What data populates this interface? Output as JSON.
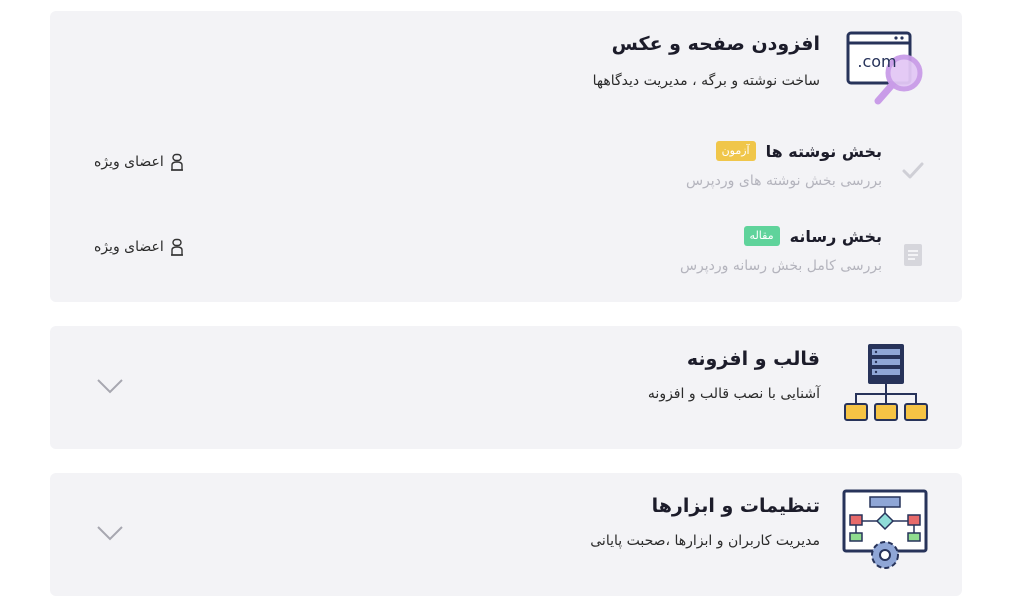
{
  "sections": [
    {
      "title": "افزودن صفحه و عکس",
      "subtitle": "ساخت نوشته و برگه ، مدیریت دیدگاهها",
      "icon": "domain-search-icon",
      "expanded": true,
      "icon_text": ".com",
      "lessons": [
        {
          "title": "بخش نوشته ها",
          "badge": "آزمون",
          "badge_color": "#f0c64a",
          "description": "بررسی بخش نوشته های وردپرس",
          "access": "اعضای ویژه",
          "icon": "check-icon"
        },
        {
          "title": "بخش رسانه",
          "badge": "مقاله",
          "badge_color": "#5fd39b",
          "description": "بررسی کامل بخش رسانه وردپرس",
          "access": "اعضای ویژه",
          "icon": "document-icon"
        }
      ]
    },
    {
      "title": "قالب و افزونه",
      "subtitle": "آشنایی با نصب قالب و افزونه",
      "icon": "server-folders-icon",
      "expanded": false
    },
    {
      "title": "تنظیمات و ابزارها",
      "subtitle": "مدیریت کاربران و ابزارها ،صحبت پایانی",
      "icon": "flowchart-gear-icon",
      "expanded": false
    }
  ],
  "colors": {
    "card_bg": "#f3f3f6",
    "badge_quiz": "#f0c64a",
    "badge_article": "#5fd39b",
    "icon_purple": "#c99ce8",
    "icon_navy": "#27335a"
  }
}
